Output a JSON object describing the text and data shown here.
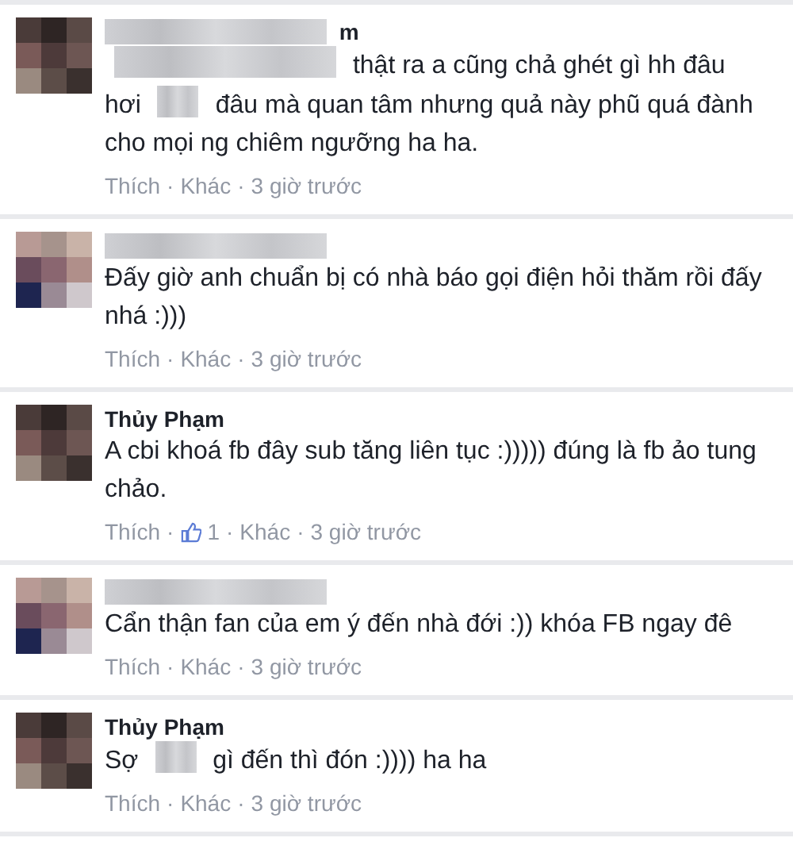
{
  "comments": [
    {
      "author": [
        {
          "kind": "redacted_long"
        },
        {
          "kind": "text",
          "text": "m"
        }
      ],
      "body": [
        [
          {
            "kind": "redacted_long"
          },
          {
            "kind": "text",
            "text": "thật ra a cũng chả ghét gì hh đâu"
          }
        ],
        [
          {
            "kind": "text",
            "text": "hơi"
          },
          {
            "kind": "redacted_short"
          },
          {
            "kind": "text",
            "text": "đâu mà quan tâm nhưng quả này phũ quá đành"
          }
        ],
        [
          {
            "kind": "text",
            "text": "cho mọi ng chiêm ngưỡng ha ha."
          }
        ]
      ],
      "actions": [
        {
          "kind": "link",
          "text": "Thích"
        },
        {
          "kind": "sep",
          "text": "·"
        },
        {
          "kind": "link",
          "text": "Khác"
        },
        {
          "kind": "sep",
          "text": "·"
        },
        {
          "kind": "time",
          "text": "3 giờ trước"
        }
      ]
    },
    {
      "author": [
        {
          "kind": "redacted_long"
        }
      ],
      "body": [
        [
          {
            "kind": "text",
            "text": "Đấy giờ anh chuẩn bị có nhà báo gọi điện hỏi thăm rồi đấy nhá :)))"
          }
        ]
      ],
      "actions": [
        {
          "kind": "link",
          "text": "Thích"
        },
        {
          "kind": "sep",
          "text": "·"
        },
        {
          "kind": "link",
          "text": "Khác"
        },
        {
          "kind": "sep",
          "text": "·"
        },
        {
          "kind": "time",
          "text": "3 giờ trước"
        }
      ]
    },
    {
      "author": [
        {
          "kind": "text",
          "text": "Thủy Phạm"
        }
      ],
      "body": [
        [
          {
            "kind": "text",
            "text": "A cbi khoá fb đây sub tăng liên tục :))))) đúng là fb ảo tung chảo."
          }
        ]
      ],
      "actions": [
        {
          "kind": "link",
          "text": "Thích"
        },
        {
          "kind": "sep",
          "text": "·"
        },
        {
          "kind": "likes",
          "text": "1"
        },
        {
          "kind": "sep",
          "text": "·"
        },
        {
          "kind": "link",
          "text": "Khác"
        },
        {
          "kind": "sep",
          "text": "·"
        },
        {
          "kind": "time",
          "text": "3 giờ trước"
        }
      ]
    },
    {
      "author": [
        {
          "kind": "redacted_long"
        }
      ],
      "body": [
        [
          {
            "kind": "text",
            "text": "Cẩn thận fan của em ý đến nhà đới :)) khóa FB ngay đê"
          }
        ]
      ],
      "actions": [
        {
          "kind": "link",
          "text": "Thích"
        },
        {
          "kind": "sep",
          "text": "·"
        },
        {
          "kind": "link",
          "text": "Khác"
        },
        {
          "kind": "sep",
          "text": "·"
        },
        {
          "kind": "time",
          "text": "3 giờ trước"
        }
      ]
    },
    {
      "author": [
        {
          "kind": "text",
          "text": "Thủy Phạm"
        }
      ],
      "body": [
        [
          {
            "kind": "text",
            "text": "Sợ"
          },
          {
            "kind": "redacted_short"
          },
          {
            "kind": "text",
            "text": "gì đến thì đón :)))) ha ha"
          }
        ]
      ],
      "actions": [
        {
          "kind": "link",
          "text": "Thích"
        },
        {
          "kind": "sep",
          "text": "·"
        },
        {
          "kind": "link",
          "text": "Khác"
        },
        {
          "kind": "sep",
          "text": "·"
        },
        {
          "kind": "time",
          "text": "3 giờ trước"
        }
      ]
    }
  ]
}
